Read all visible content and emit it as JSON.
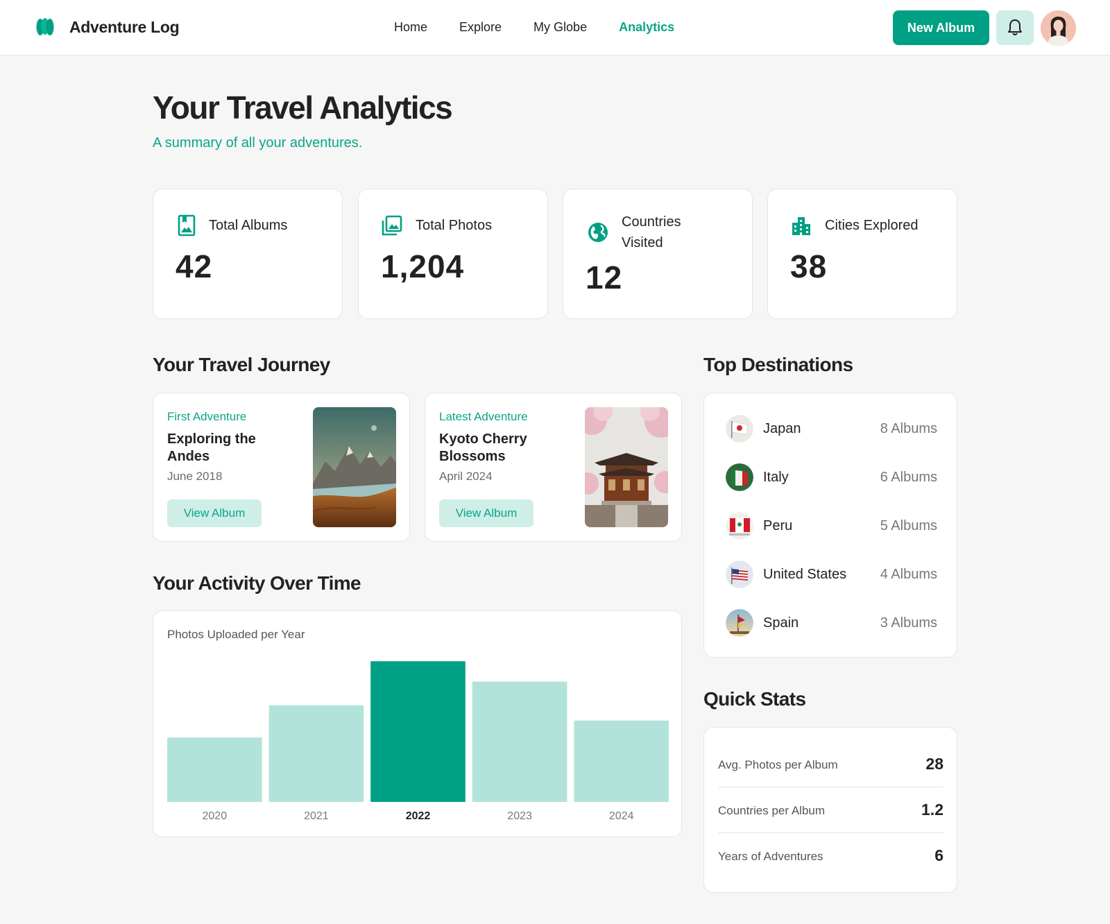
{
  "header": {
    "brand": "Adventure Log",
    "nav": [
      "Home",
      "Explore",
      "My Globe",
      "Analytics"
    ],
    "active_nav": "Analytics",
    "new_album_label": "New Album"
  },
  "page": {
    "title": "Your Travel Analytics",
    "subtitle": "A summary of all your adventures."
  },
  "stats": [
    {
      "label": "Total Albums",
      "value": "42",
      "icon": "album-icon"
    },
    {
      "label": "Total Photos",
      "value": "1,204",
      "icon": "photos-icon"
    },
    {
      "label": "Countries Visited",
      "value": "12",
      "icon": "globe-icon"
    },
    {
      "label": "Cities Explored",
      "value": "38",
      "icon": "city-icon"
    }
  ],
  "journey": {
    "title": "Your Travel Journey",
    "cards": [
      {
        "tag": "First Adventure",
        "title": "Exploring the Andes",
        "date": "June 2018",
        "button": "View Album"
      },
      {
        "tag": "Latest Adventure",
        "title": "Kyoto Cherry Blossoms",
        "date": "April 2024",
        "button": "View Album"
      }
    ]
  },
  "activity": {
    "title": "Your Activity Over Time",
    "chart_title": "Photos Uploaded per Year"
  },
  "chart_data": {
    "type": "bar",
    "title": "Photos Uploaded per Year",
    "categories": [
      "2020",
      "2021",
      "2022",
      "2023",
      "2024"
    ],
    "values": [
      190,
      285,
      415,
      355,
      240
    ],
    "highlight": "2022",
    "ylim": [
      0,
      440
    ],
    "colors": {
      "base": "#b2e3da",
      "highlight": "#00a084"
    }
  },
  "destinations": {
    "title": "Top Destinations",
    "items": [
      {
        "name": "Japan",
        "count": "8 Albums"
      },
      {
        "name": "Italy",
        "count": "6 Albums"
      },
      {
        "name": "Peru",
        "count": "5 Albums"
      },
      {
        "name": "United States",
        "count": "4 Albums"
      },
      {
        "name": "Spain",
        "count": "3 Albums"
      }
    ]
  },
  "quick_stats": {
    "title": "Quick Stats",
    "items": [
      {
        "label": "Avg. Photos per Album",
        "value": "28"
      },
      {
        "label": "Countries per Album",
        "value": "1.2"
      },
      {
        "label": "Years of Adventures",
        "value": "6"
      }
    ]
  },
  "colors": {
    "accent": "#00a084",
    "accent_light": "#cfeee7",
    "background": "#f6f6f6"
  }
}
